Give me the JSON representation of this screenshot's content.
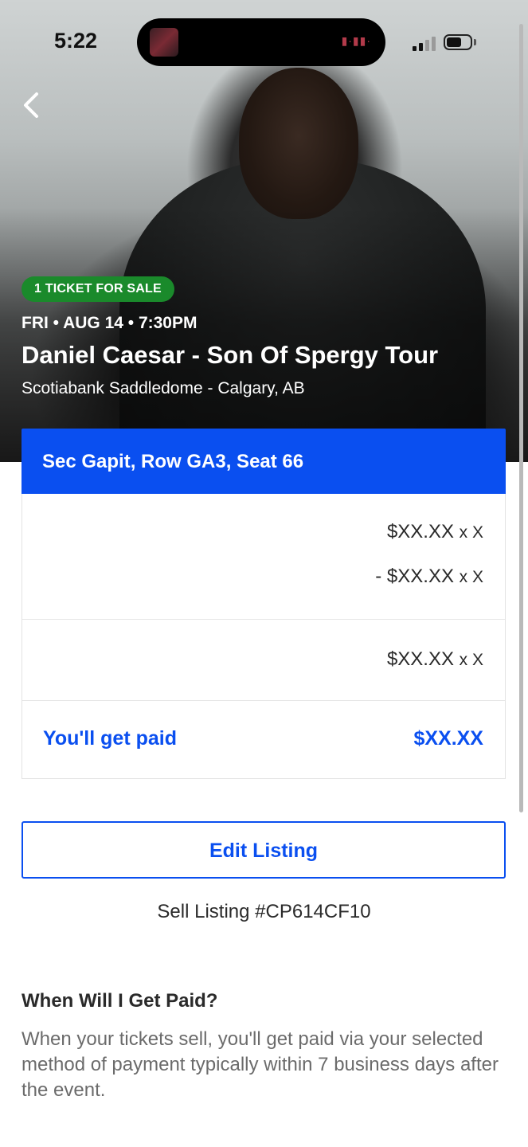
{
  "status_bar": {
    "time": "5:22"
  },
  "event": {
    "badge": "1 TICKET FOR SALE",
    "date": "FRI • AUG 14 • 7:30PM",
    "title": "Daniel Caesar - Son Of Spergy Tour",
    "venue": "Scotiabank Saddledome - Calgary, AB"
  },
  "seat": {
    "label": "Sec Gapit, Row GA3, Seat 66"
  },
  "breakdown": {
    "lines": [
      {
        "amount": "$XX.XX",
        "multiplier": "x X"
      },
      {
        "amount": "- $XX.XX",
        "multiplier": "x X"
      },
      {
        "amount": "$XX.XX",
        "multiplier": "x X"
      }
    ],
    "paid_label": "You'll get paid",
    "paid_value": "$XX.XX"
  },
  "actions": {
    "edit_label": "Edit Listing"
  },
  "listing": {
    "id_text": "Sell Listing #CP614CF10"
  },
  "faq": {
    "title": "When Will I Get Paid?",
    "body": "When your tickets sell, you'll get paid via your selected method of payment typically within 7 business days after the event."
  },
  "colors": {
    "accent": "#0a4ff0",
    "badge_green": "#1a8a2b"
  },
  "icons": {
    "back": "chevron-left-icon"
  }
}
